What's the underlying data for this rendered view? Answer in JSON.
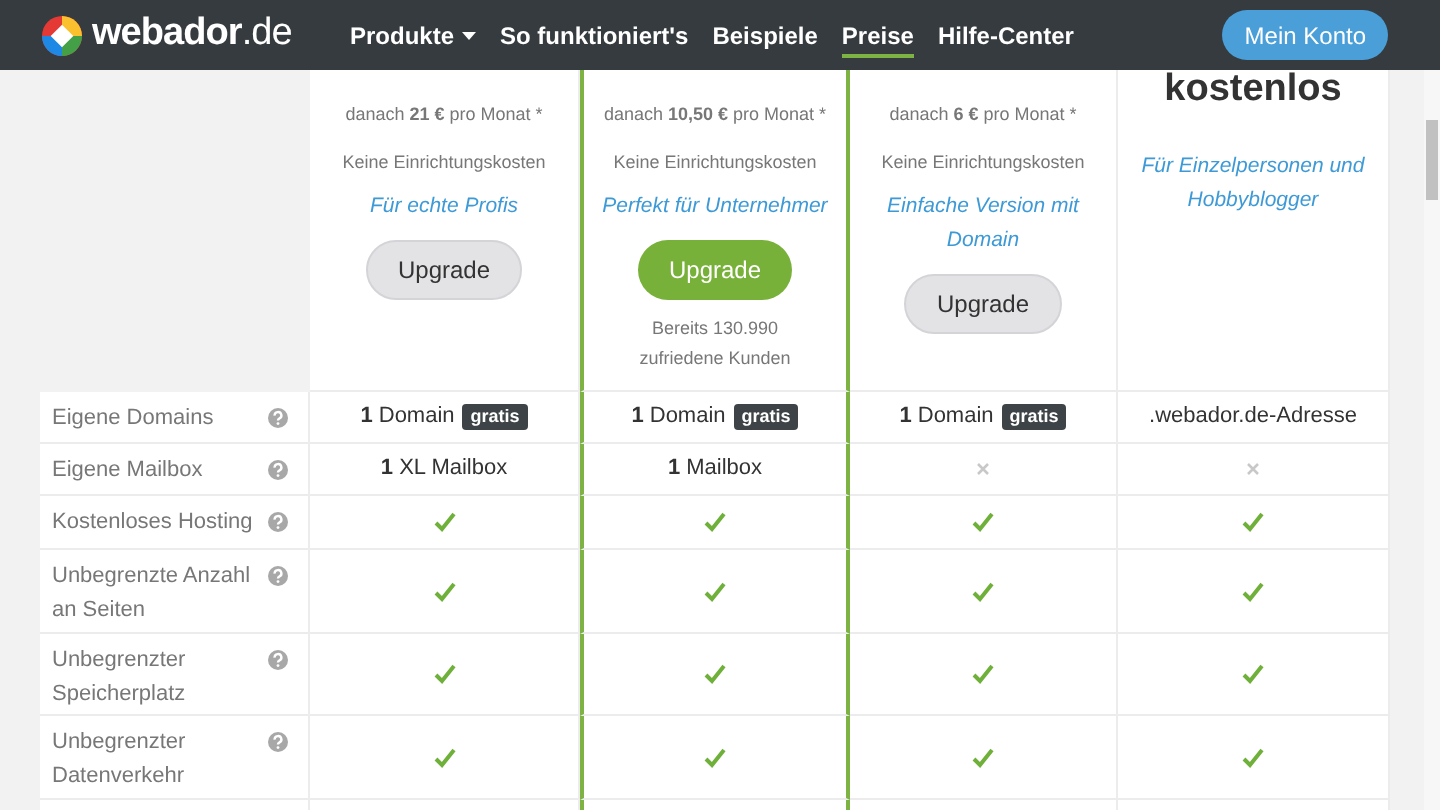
{
  "nav": {
    "logo": "webador",
    "logo_suffix": ".de",
    "links": [
      {
        "label": "Produkte",
        "dropdown": true,
        "selected": false
      },
      {
        "label": "So funktioniert's",
        "dropdown": false,
        "selected": false
      },
      {
        "label": "Beispiele",
        "dropdown": false,
        "selected": false
      },
      {
        "label": "Preise",
        "dropdown": false,
        "selected": true
      },
      {
        "label": "Hilfe-Center",
        "dropdown": false,
        "selected": false
      }
    ],
    "account_button": "Mein Konto"
  },
  "plans": [
    {
      "highlighted": false,
      "after_price": "danach **21 €** pro Monat *",
      "setup": "Keine Einrichtungskosten",
      "tagline": "Für echte Profis",
      "button": {
        "label": "Upgrade",
        "kind": "secondary"
      }
    },
    {
      "highlighted": true,
      "after_price": "danach **10,50 €** pro Monat *",
      "setup": "Keine Einrichtungskosten",
      "tagline": "Perfekt für Unternehmer",
      "button": {
        "label": "Upgrade",
        "kind": "primary"
      },
      "note": "Bereits 130.990 zufriedene Kunden"
    },
    {
      "highlighted": false,
      "after_price": "danach **6 €** pro Monat *",
      "setup": "Keine Einrichtungskosten",
      "tagline": "Einfache Version mit Domain",
      "button": {
        "label": "Upgrade",
        "kind": "secondary"
      }
    },
    {
      "highlighted": false,
      "price": "kostenlos",
      "tagline": "Für Einzelpersonen und Hobbyblogger"
    }
  ],
  "features": [
    {
      "label": "Eigene Domains",
      "cells": [
        {
          "kind": "text",
          "text": "**1** Domain",
          "badge": "gratis"
        },
        {
          "kind": "text",
          "text": "**1** Domain",
          "badge": "gratis"
        },
        {
          "kind": "text",
          "text": "**1** Domain",
          "badge": "gratis"
        },
        {
          "kind": "text",
          "text": ".webador.de-Adresse"
        }
      ]
    },
    {
      "label": "Eigene Mailbox",
      "cells": [
        {
          "kind": "text",
          "text": "**1** XL Mailbox"
        },
        {
          "kind": "text",
          "text": "**1** Mailbox"
        },
        {
          "kind": "cross"
        },
        {
          "kind": "cross"
        }
      ]
    },
    {
      "label": "Kostenloses Hosting",
      "cells": [
        {
          "kind": "check"
        },
        {
          "kind": "check"
        },
        {
          "kind": "check"
        },
        {
          "kind": "check"
        }
      ]
    },
    {
      "label": "Unbegrenzte Anzahl an Seiten",
      "cells": [
        {
          "kind": "check"
        },
        {
          "kind": "check"
        },
        {
          "kind": "check"
        },
        {
          "kind": "check"
        }
      ]
    },
    {
      "label": "Unbegrenzter Speicherplatz",
      "cells": [
        {
          "kind": "check"
        },
        {
          "kind": "check"
        },
        {
          "kind": "check"
        },
        {
          "kind": "check"
        }
      ]
    },
    {
      "label": "Unbegrenzter Datenverkehr",
      "cells": [
        {
          "kind": "check"
        },
        {
          "kind": "check"
        },
        {
          "kind": "check"
        },
        {
          "kind": "check"
        }
      ]
    }
  ]
}
